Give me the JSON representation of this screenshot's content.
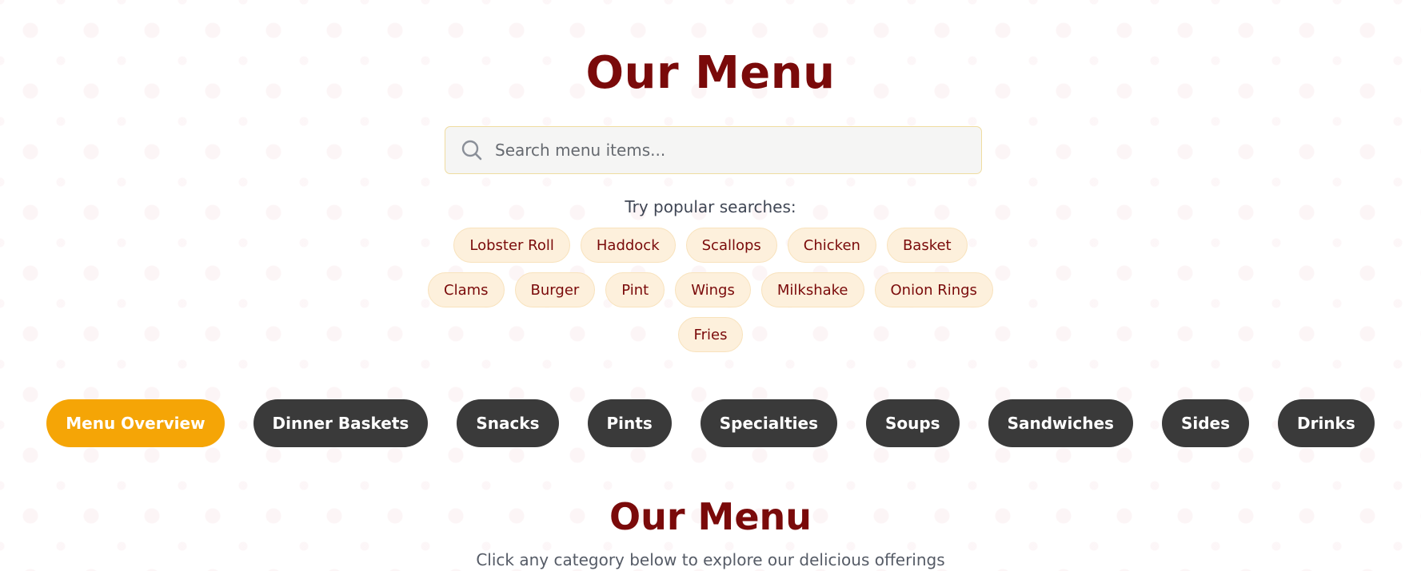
{
  "header": {
    "title": "Our Menu"
  },
  "search": {
    "placeholder": "Search menu items...",
    "value": "",
    "icon": "search-icon"
  },
  "popular": {
    "label": "Try popular searches:",
    "rows": [
      [
        "Lobster Roll",
        "Haddock",
        "Scallops",
        "Chicken",
        "Basket"
      ],
      [
        "Clams",
        "Burger",
        "Pint",
        "Wings",
        "Milkshake",
        "Onion Rings"
      ],
      [
        "Fries"
      ]
    ]
  },
  "tabs": [
    {
      "label": "Menu Overview",
      "active": true
    },
    {
      "label": "Dinner Baskets",
      "active": false
    },
    {
      "label": "Snacks",
      "active": false
    },
    {
      "label": "Pints",
      "active": false
    },
    {
      "label": "Specialties",
      "active": false
    },
    {
      "label": "Soups",
      "active": false
    },
    {
      "label": "Sandwiches",
      "active": false
    },
    {
      "label": "Sides",
      "active": false
    },
    {
      "label": "Drinks",
      "active": false
    }
  ],
  "section": {
    "title": "Our Menu",
    "subtitle": "Click any category below to explore our delicious offerings"
  },
  "colors": {
    "brand": "#7a0a0a",
    "accent": "#f5a506",
    "tab_bg": "#3a3a3a",
    "chip_bg": "#fdf0dc"
  }
}
